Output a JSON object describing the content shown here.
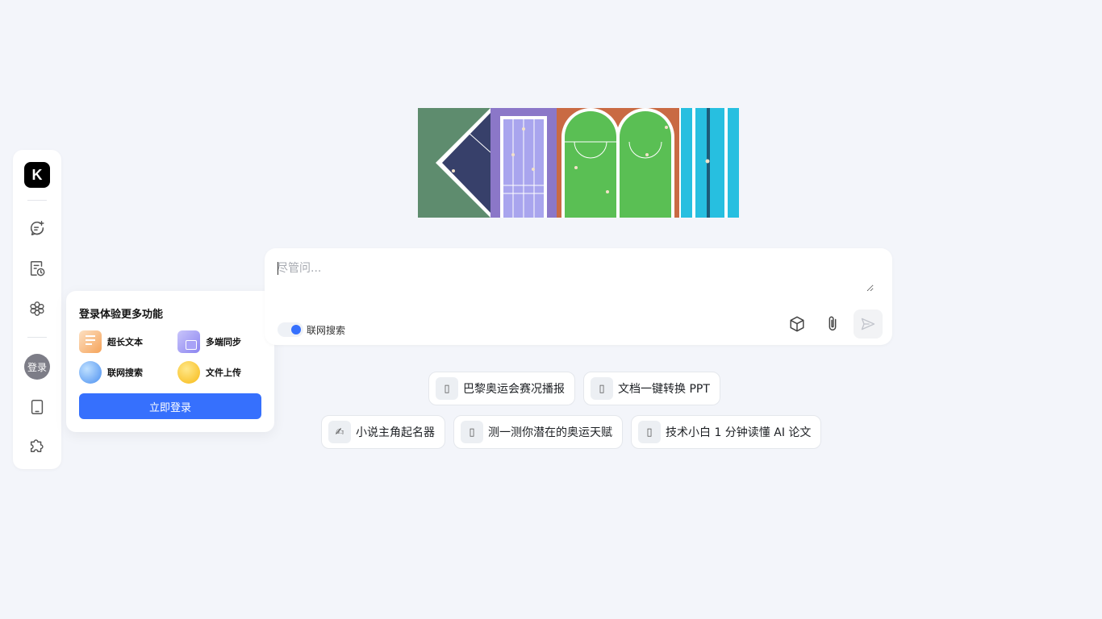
{
  "sidebar": {
    "logo_text": "K",
    "items": [
      {
        "name": "new-chat",
        "icon": "chat-plus-icon"
      },
      {
        "name": "history",
        "icon": "history-doc-icon"
      },
      {
        "name": "explore",
        "icon": "flower-icon"
      }
    ],
    "avatar_label": "登录",
    "bottom_items": [
      {
        "name": "mobile",
        "icon": "tablet-icon"
      },
      {
        "name": "plugin",
        "icon": "puzzle-icon"
      }
    ]
  },
  "login_popover": {
    "title": "登录体验更多功能",
    "features": [
      {
        "label": "超长文本",
        "icon": "long-text-icon",
        "color": "#f5a35a"
      },
      {
        "label": "多端同步",
        "icon": "multi-device-sync-icon",
        "color": "#8b84f0"
      },
      {
        "label": "联网搜索",
        "icon": "globe-search-icon",
        "color": "#5a9cf0"
      },
      {
        "label": "文件上传",
        "icon": "file-upload-icon",
        "color": "#f7c531"
      }
    ],
    "button_label": "立即登录"
  },
  "chat": {
    "placeholder": "尽管问...",
    "web_search_label": "联网搜索",
    "web_search_enabled": true
  },
  "suggestions": {
    "row1": [
      {
        "label": "巴黎奥运会赛况播报",
        "icon": "▯"
      },
      {
        "label": "文档一键转换 PPT",
        "icon": "▯"
      }
    ],
    "row2": [
      {
        "label": "小说主角起名器",
        "icon": "✍"
      },
      {
        "label": "测一测你潜在的奥运天赋",
        "icon": "▯"
      },
      {
        "label": "技术小白 1 分钟读懂 AI 论文",
        "icon": "▯"
      }
    ]
  },
  "colors": {
    "background": "#f3f5fa",
    "accent": "#3670fd"
  }
}
